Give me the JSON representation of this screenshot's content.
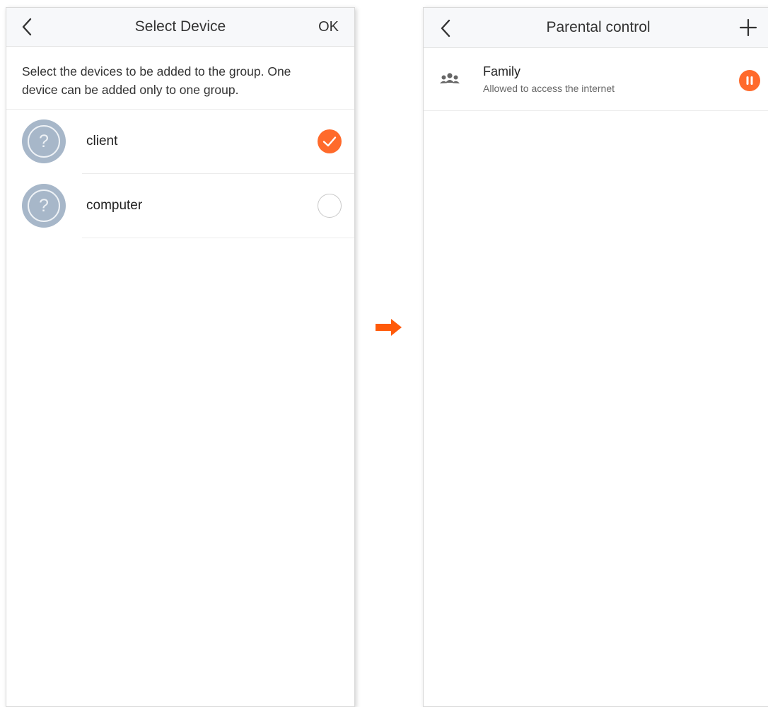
{
  "left_screen": {
    "title": "Select Device",
    "ok_label": "OK",
    "instructions": "Select the devices to be added to the group. One device can be added only to one group.",
    "avatar_glyph": "?",
    "devices": [
      {
        "name": "client",
        "selected": true
      },
      {
        "name": "computer",
        "selected": false
      }
    ]
  },
  "right_screen": {
    "title": "Parental control",
    "groups": [
      {
        "name": "Family",
        "status": "Allowed to access the internet"
      }
    ]
  },
  "icons": {
    "back": "chevron-left-icon",
    "add": "plus-icon",
    "group": "group-people-icon",
    "pause": "pause-icon",
    "check": "check-icon",
    "device": "unknown-device-icon",
    "flow": "arrow-right-icon"
  },
  "colors": {
    "accent": "#ff6a2b",
    "avatar": "#a7b7c9",
    "navbar": "#f7f8fa"
  }
}
